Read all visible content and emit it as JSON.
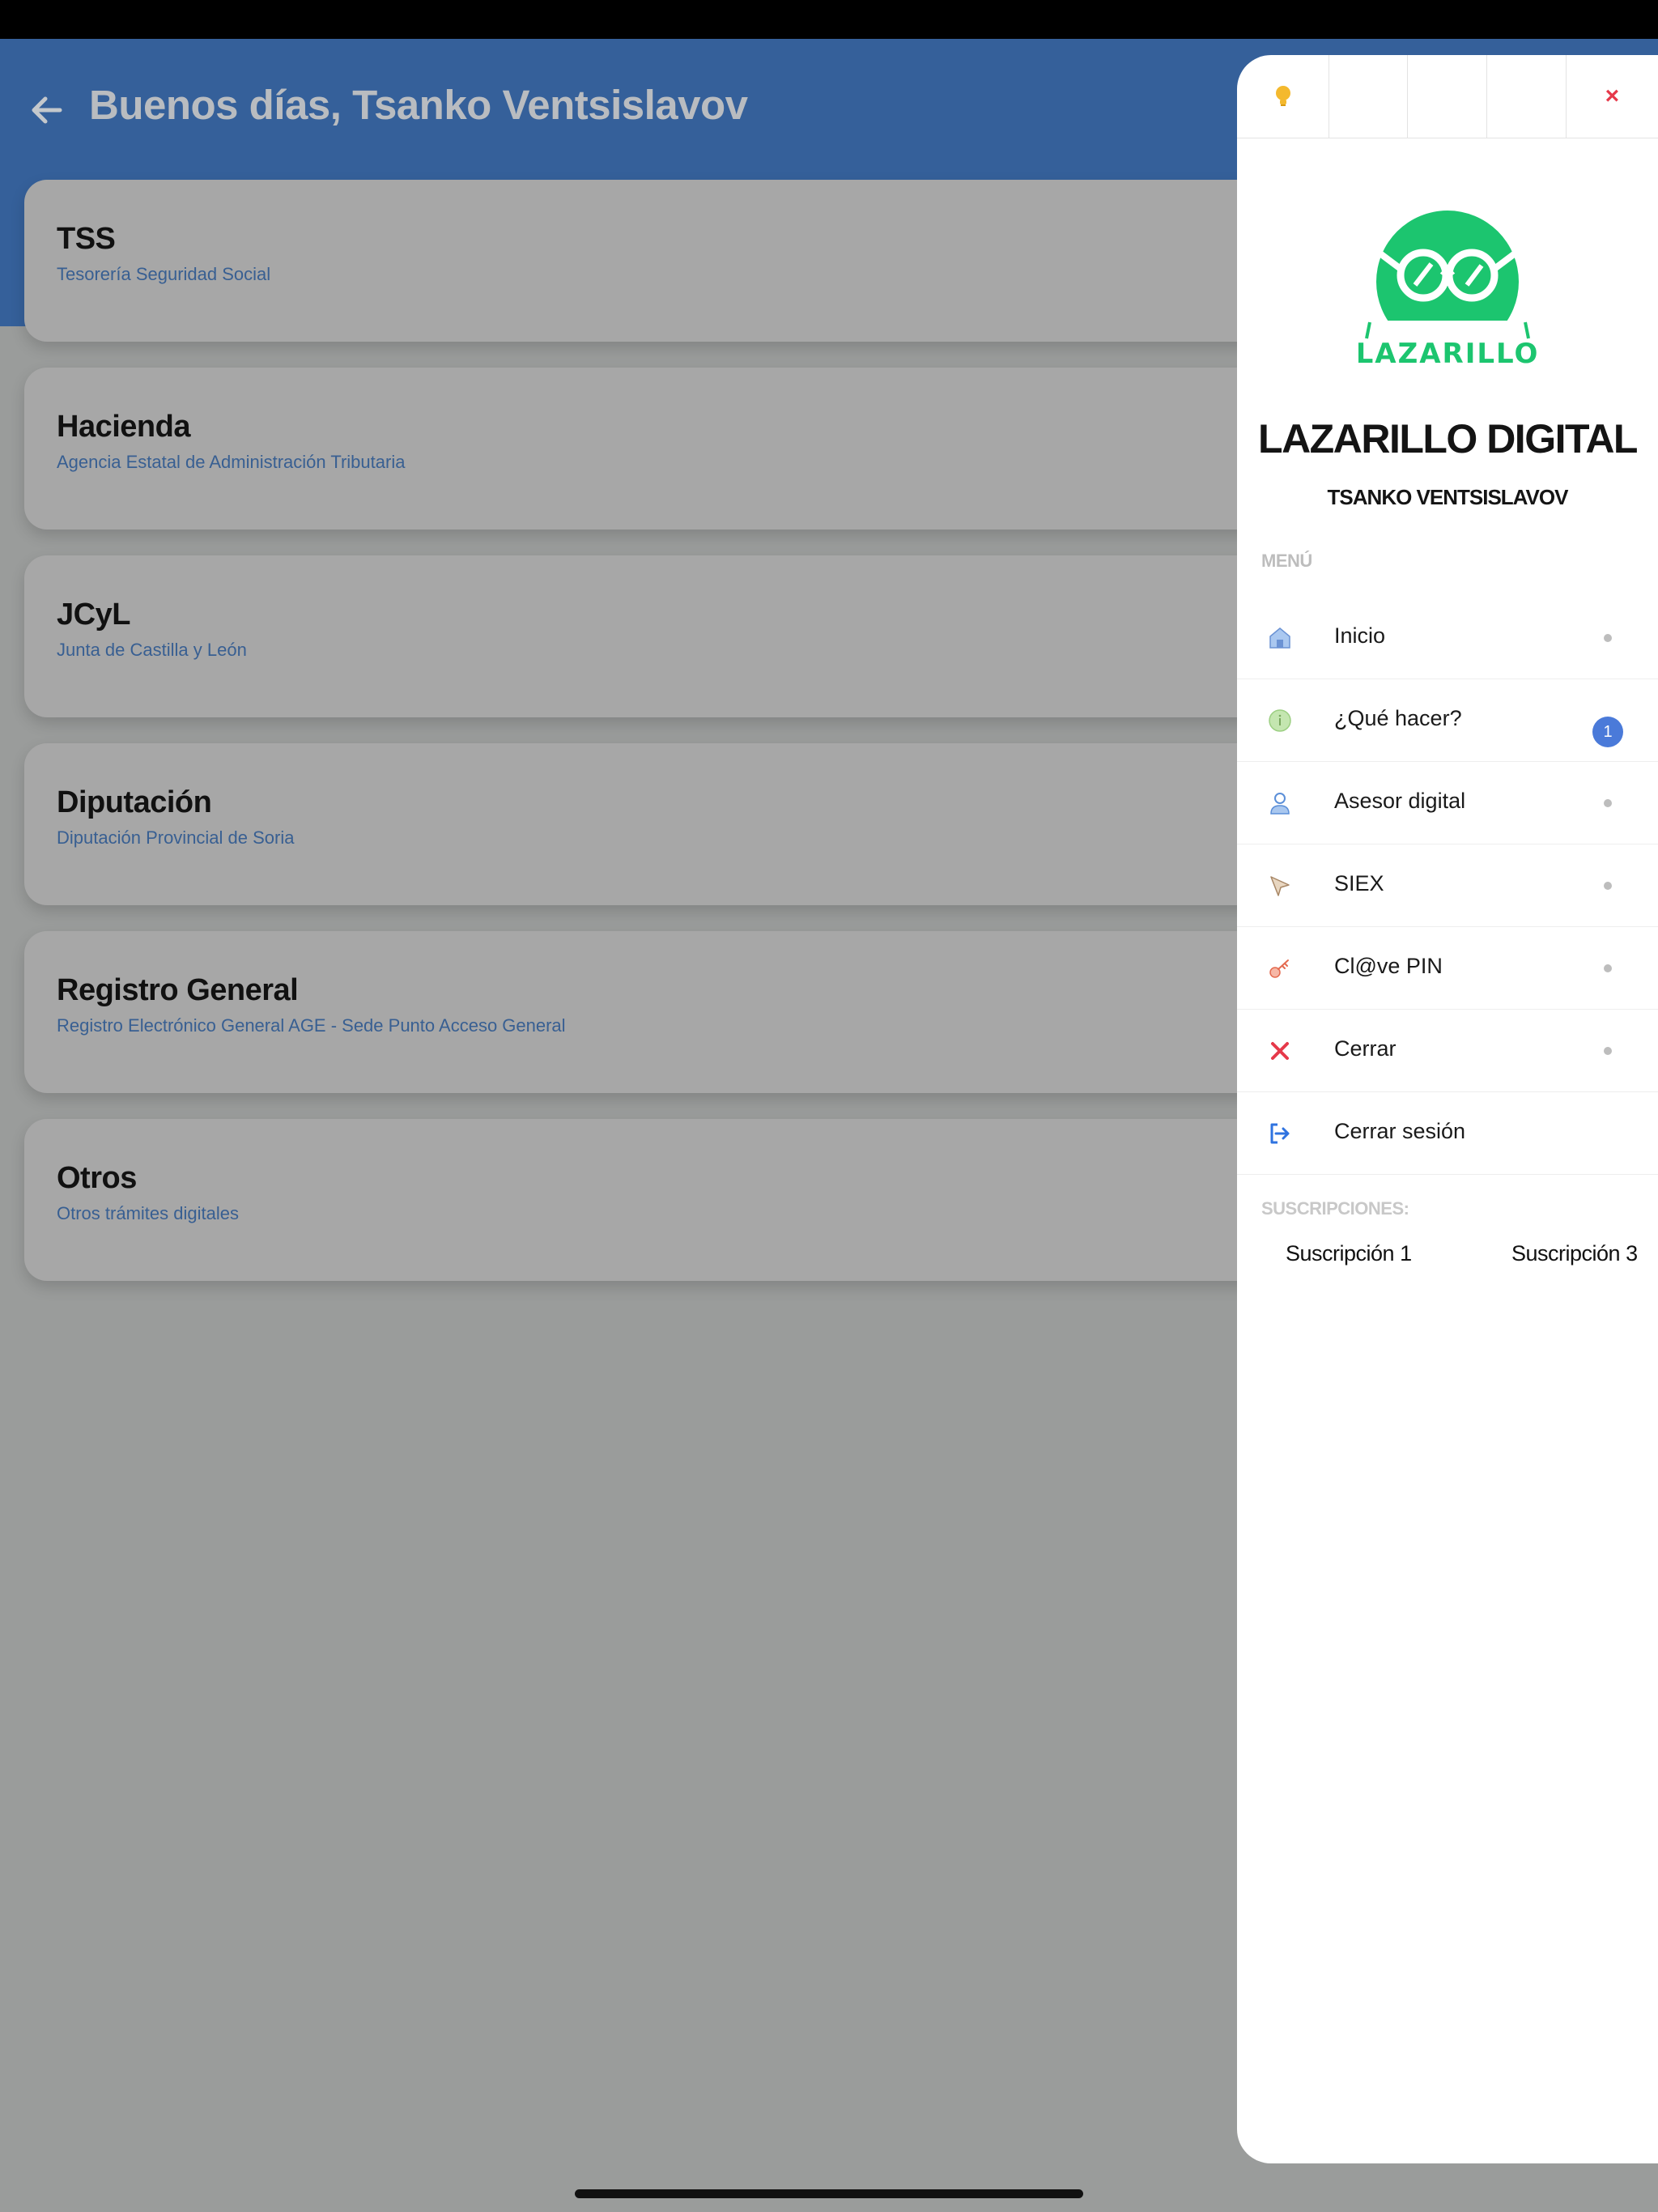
{
  "header": {
    "title": "Buenos días, Tsanko Ventsislavov"
  },
  "cards": [
    {
      "title": "TSS",
      "subtitle": "Tesorería Seguridad Social"
    },
    {
      "title": "Hacienda",
      "subtitle": "Agencia Estatal de Administración Tributaria"
    },
    {
      "title": "JCyL",
      "subtitle": "Junta de Castilla y León"
    },
    {
      "title": "Diputación",
      "subtitle": "Diputación Provincial de Soria"
    },
    {
      "title": "Registro General",
      "subtitle": "Registro Electrónico General AGE - Sede Punto Acceso General"
    },
    {
      "title": "Otros",
      "subtitle": "Otros trámites digitales"
    }
  ],
  "drawer": {
    "toolbar": {
      "close_label": "×",
      "icons": [
        "lightbulb-icon",
        "close-icon"
      ]
    },
    "logo_text": "LAZARILLO",
    "brand": "LAZARILLO DIGITAL",
    "username": "TSANKO VENTSISLAVOV",
    "menu_label": "MENÚ",
    "menu": [
      {
        "label": "Inicio",
        "icon": "home-icon"
      },
      {
        "label": "¿Qué hacer?",
        "icon": "info-icon",
        "badge": "1"
      },
      {
        "label": "Asesor digital",
        "icon": "user-icon"
      },
      {
        "label": "SIEX",
        "icon": "cursor-icon"
      },
      {
        "label": "Cl@ve PIN",
        "icon": "key-icon"
      },
      {
        "label": "Cerrar",
        "icon": "close-icon"
      },
      {
        "label": "Cerrar sesión",
        "icon": "logout-icon"
      }
    ],
    "subscriptions_label": "SUSCRIPCIONES:",
    "subscriptions": [
      "Suscripción 1",
      "Suscripción 3"
    ]
  },
  "colors": {
    "header_blue": "#35609a",
    "brand_green": "#1cc56f",
    "badge_blue": "#4a7ad9",
    "close_red": "#e6394a",
    "overlay_gray": "#9a9c9b"
  }
}
